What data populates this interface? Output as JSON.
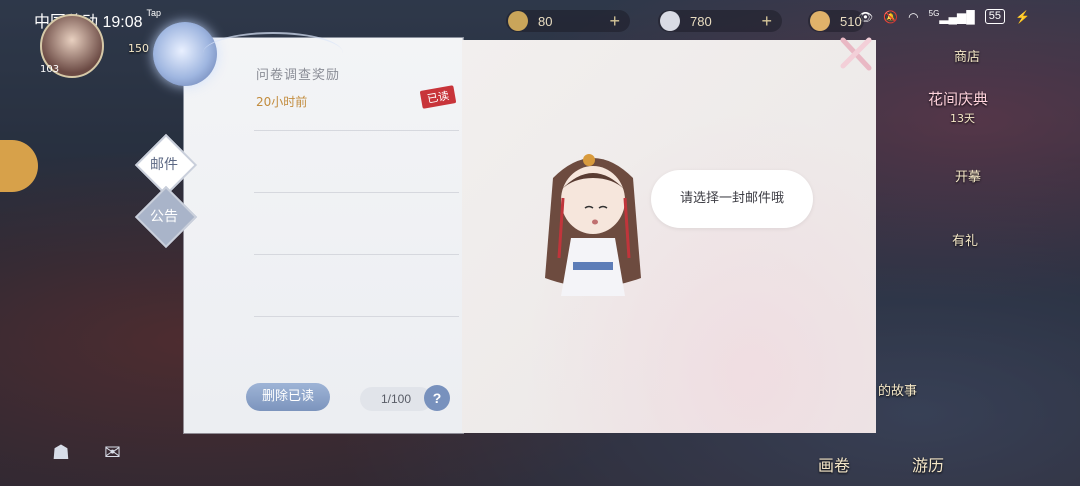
{
  "status_bar": {
    "carrier": "中国移动",
    "time": "19:08",
    "tap": "Tap",
    "network": "5G",
    "battery": "55"
  },
  "resources": [
    {
      "value": "80",
      "color": "#c9a55a"
    },
    {
      "value": "780",
      "color": "#d9dbe4"
    },
    {
      "value": "510",
      "color": "#e0b26a"
    }
  ],
  "player": {
    "level": "103",
    "points": "150"
  },
  "side": {
    "shop": "商店",
    "festival": "花间庆典",
    "festival_days": "13天",
    "lottery": "开摹",
    "gift": "有礼",
    "story": "的故事",
    "scroll": "画卷",
    "travel": "游历"
  },
  "mail_panel": {
    "tabs": {
      "mail": "邮件",
      "notice": "公告"
    },
    "items": [
      {
        "title": "问卷调查奖励",
        "time": "20小时前",
        "status": "已读"
      }
    ],
    "delete_read_label": "删除已读",
    "counter": "1/100",
    "help_label": "?",
    "empty_prompt": "请选择一封邮件哦"
  },
  "colors": {
    "accent_blue": "#7c94bd",
    "time_orange": "#c28c3e",
    "stamp_red": "#c8343a"
  }
}
